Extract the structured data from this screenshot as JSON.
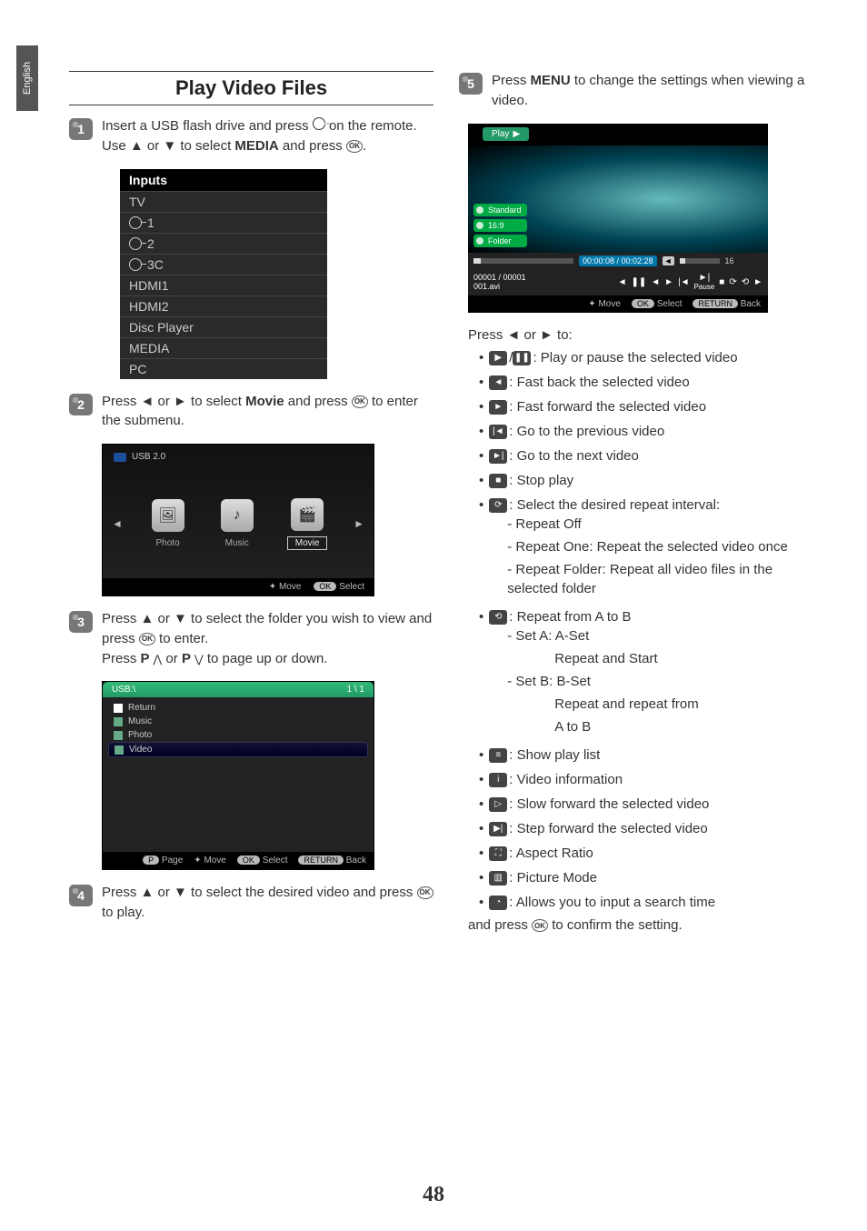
{
  "lang_tab": "English",
  "left": {
    "section_title": "Play Video Files",
    "step1": {
      "num": "1",
      "line1a": "Insert a USB flash drive and press ",
      "line1b": " on the remote.",
      "line2a": "Use ▲ or ▼ to select ",
      "line2_bold": "MEDIA",
      "line2b": " and press ",
      "ok": "OK",
      "line2c": "."
    },
    "inputs": {
      "header": "Inputs",
      "rows": [
        "TV",
        "1",
        "2",
        "3C",
        "HDMI1",
        "HDMI2",
        "Disc Player",
        "MEDIA",
        "PC"
      ]
    },
    "step2": {
      "num": "2",
      "line_a": "Press ◄ or ► to select ",
      "line_bold": "Movie",
      "line_b": " and press ",
      "ok": "OK",
      "line_c": " to enter the submenu."
    },
    "osd": {
      "usb": "USB 2.0",
      "modes": [
        "Photo",
        "Music",
        "Movie"
      ],
      "move": "Move",
      "ok": "OK",
      "select": "Select"
    },
    "step3": {
      "num": "3",
      "line_a": "Press ▲ or ▼ to select the folder you wish to view and press ",
      "ok": "OK",
      "line_b": " to enter.",
      "line2a": "Press ",
      "p1": "P ",
      "line2mid": " or ",
      "p2": "P ",
      "line2b": " to page up or down."
    },
    "files": {
      "path": "USB:\\",
      "count": "1 \\ 1",
      "rows": [
        "Return",
        "Music",
        "Photo",
        "Video"
      ],
      "page": "Page",
      "pkey": "P",
      "move": "Move",
      "ok": "OK",
      "select": "Select",
      "ret": "RETURN",
      "back": "Back"
    },
    "step4": {
      "num": "4",
      "line_a": "Press ▲ or ▼ to select the desired video and press ",
      "ok": "OK",
      "line_b": " to play."
    }
  },
  "right": {
    "step5": {
      "num": "5",
      "line_a": "Press ",
      "line_bold": "MENU",
      "line_b": " to change the settings when viewing a video."
    },
    "player": {
      "play": "Play",
      "badges": [
        "Standard",
        "16:9",
        "Folder"
      ],
      "time": "00:00:08 / 00:02:28",
      "vol_num": "16",
      "counter": "00001 / 00001",
      "fname": "001.avi",
      "pause": "Pause",
      "move": "Move",
      "ok": "OK",
      "select": "Select",
      "ret": "RETURN",
      "back": "Back"
    },
    "press_lr": "Press ◄ or ► to:",
    "items": {
      "playpause": ": Play or pause the selected video",
      "fastback": ": Fast back the selected video",
      "fastfwd": ": Fast forward the selected video",
      "prev": ": Go to the previous video",
      "next": ": Go to the next video",
      "stop": ": Stop play",
      "repeat_head": ": Select the desired repeat interval:",
      "repeat_off": "- Repeat Off",
      "repeat_one": "- Repeat One: Repeat the selected video once",
      "repeat_folder": "- Repeat Folder: Repeat all video files in the selected folder",
      "ab_head": ": Repeat from A to B",
      "set_a": "- Set A: A-Set",
      "set_a_sub": "Repeat and Start",
      "set_b": "- Set B: B-Set",
      "set_b_sub1": "Repeat and repeat from",
      "set_b_sub2": "A to B",
      "playlist": ": Show play list",
      "info": ": Video information",
      "slowfwd": ": Slow forward the selected video",
      "stepfwd": ": Step forward the selected video",
      "aspect": ": Aspect Ratio",
      "picture": ": Picture Mode",
      "search": ": Allows you to input a search time"
    },
    "confirm_a": "and press ",
    "confirm_ok": "OK",
    "confirm_b": " to confirm the setting."
  },
  "page_number": "48"
}
